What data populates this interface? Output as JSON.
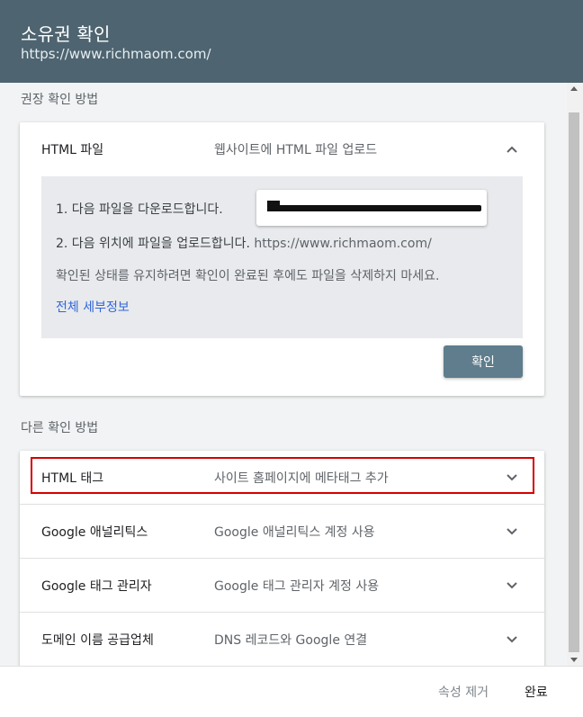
{
  "header": {
    "title": "소유권 확인",
    "url": "https://www.richmaom.com/"
  },
  "recommended": {
    "section_label": "권장 확인 방법",
    "method_name": "HTML 파일",
    "method_desc": "웹사이트에 HTML 파일 업로드",
    "step1": "1. 다음 파일을 다운로드합니다.",
    "step2_label": "2. 다음 위치에 파일을 업로드합니다.",
    "step2_url": "https://www.richmaom.com/",
    "note": "확인된 상태를 유지하려면 확인이 완료된 후에도 파일을 삭제하지 마세요.",
    "details_link": "전체 세부정보",
    "confirm_button": "확인"
  },
  "other": {
    "section_label": "다른 확인 방법",
    "methods": [
      {
        "name": "HTML 태그",
        "desc": "사이트 홈페이지에 메타태그 추가"
      },
      {
        "name": "Google 애널리틱스",
        "desc": "Google 애널리틱스 계정 사용"
      },
      {
        "name": "Google 태그 관리자",
        "desc": "Google 태그 관리자 계정 사용"
      },
      {
        "name": "도메인 이름 공급업체",
        "desc": "DNS 레코드와 Google 연결"
      }
    ]
  },
  "footer": {
    "remove_label": "속성 제거",
    "done_label": "완료"
  },
  "colors": {
    "header_bg": "#4e6470",
    "button_bg": "#5f7d8c",
    "link": "#3367d6",
    "highlight": "#d50000"
  }
}
